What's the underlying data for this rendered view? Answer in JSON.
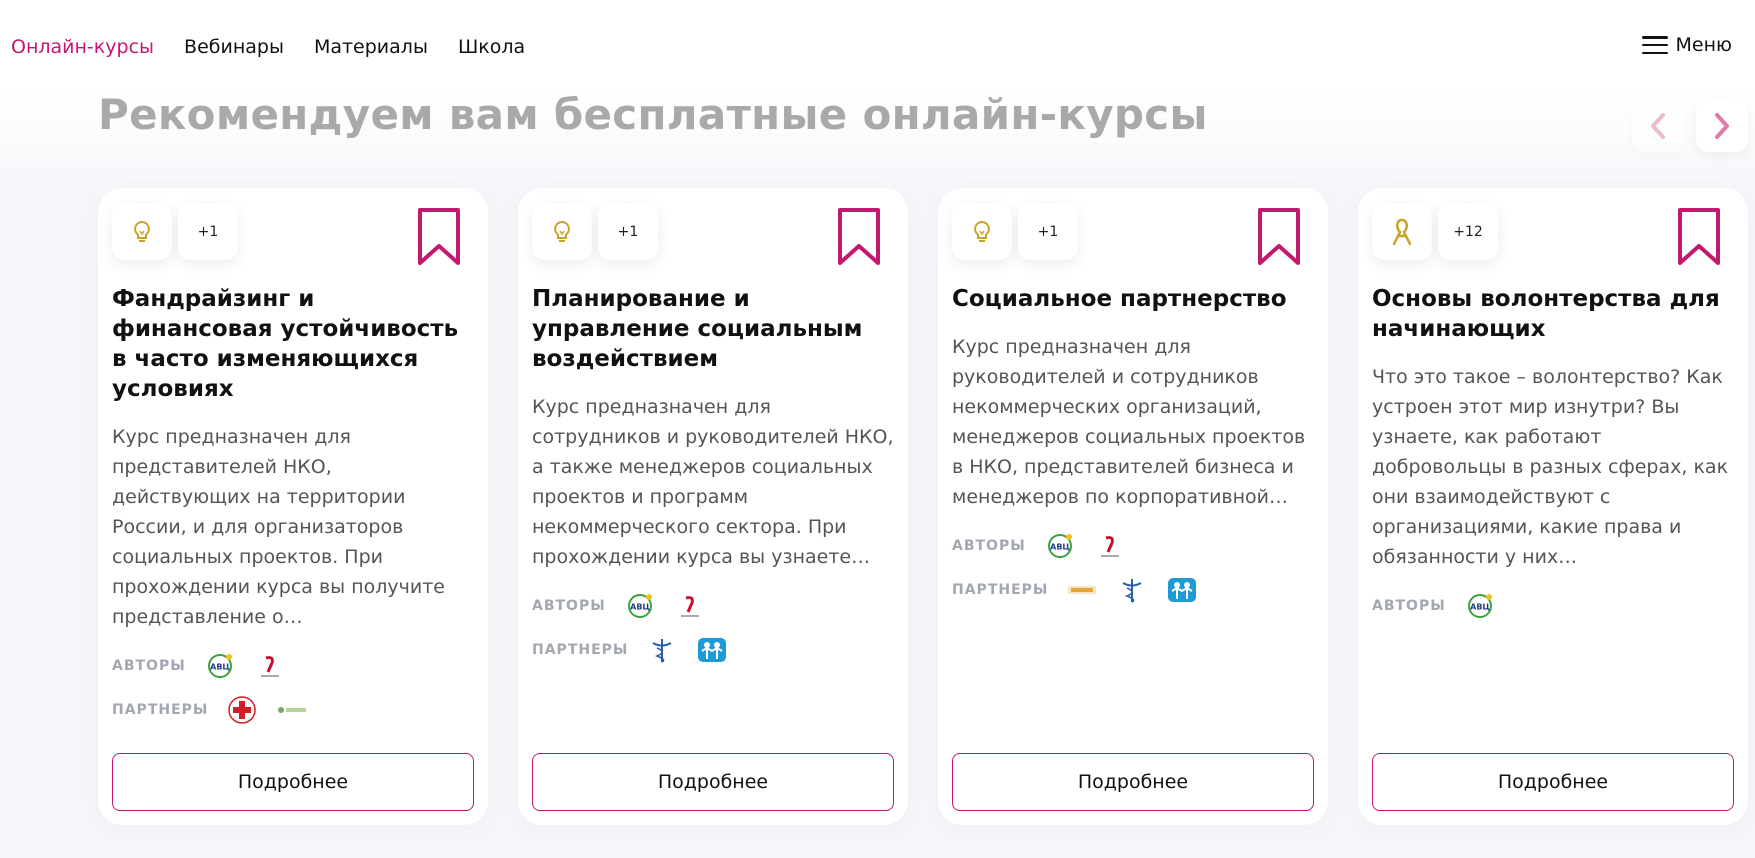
{
  "nav": {
    "items": [
      "Онлайн-курсы",
      "Вебинары",
      "Материалы",
      "Школа"
    ],
    "menu_label": "Меню"
  },
  "section": {
    "title": "Рекомендуем вам бесплатные онлайн-курсы"
  },
  "colors": {
    "accent": "#c2196e",
    "title_gray": "#a9a9a9",
    "badge_gold": "#c9a227"
  },
  "labels": {
    "authors": "АВТОРЫ",
    "partners": "ПАРТНЕРЫ",
    "more": "Подробнее"
  },
  "cards": [
    {
      "badge_icon": "lightbulb-icon",
      "badge_count": "+1",
      "title": "Фандрайзинг и финансовая устойчивость в часто изменяющихся условиях",
      "description": "Курс предназначен для представителей НКО, действующих на территории России, и для организаторов социальных проектов. При прохождении курса вы получите представление о…",
      "authors": [
        "avc-logo",
        "rosstrakh-logo"
      ],
      "partners": [
        "red-cross-logo",
        "green-org-logo"
      ]
    },
    {
      "badge_icon": "lightbulb-icon",
      "badge_count": "+1",
      "title": "Планирование и управление социальным воздействием",
      "description": "Курс предназначен для сотрудников и руководителей НКО, а также менеджеров социальных проектов и программ некоммерческого сектора. При прохождении курса вы узнаете…",
      "authors": [
        "avc-logo",
        "rosstrakh-logo"
      ],
      "partners": [
        "caduceus-logo",
        "children-logo"
      ]
    },
    {
      "badge_icon": "lightbulb-icon",
      "badge_count": "+1",
      "title": "Социальное партнерство",
      "description": "Курс предназначен для руководителей и сотрудников некоммерческих организаций, менеджеров социальных проектов в НКО, представителей бизнеса и менеджеров по корпоративной…",
      "authors": [
        "avc-logo",
        "rosstrakh-logo"
      ],
      "partners": [
        "dgood-logo",
        "caduceus-logo",
        "children-logo"
      ]
    },
    {
      "badge_icon": "ribbon-icon",
      "badge_count": "+12",
      "title": "Основы волонтерства для начинающих",
      "description": "Что это такое – волонтерство? Как устроен этот мир изнутри? Вы узнаете, как работают добровольцы в разных сферах, как они взаимодействуют с организациями, какие права и обязанности у них…",
      "authors": [
        "avc-logo"
      ],
      "partners": []
    }
  ]
}
